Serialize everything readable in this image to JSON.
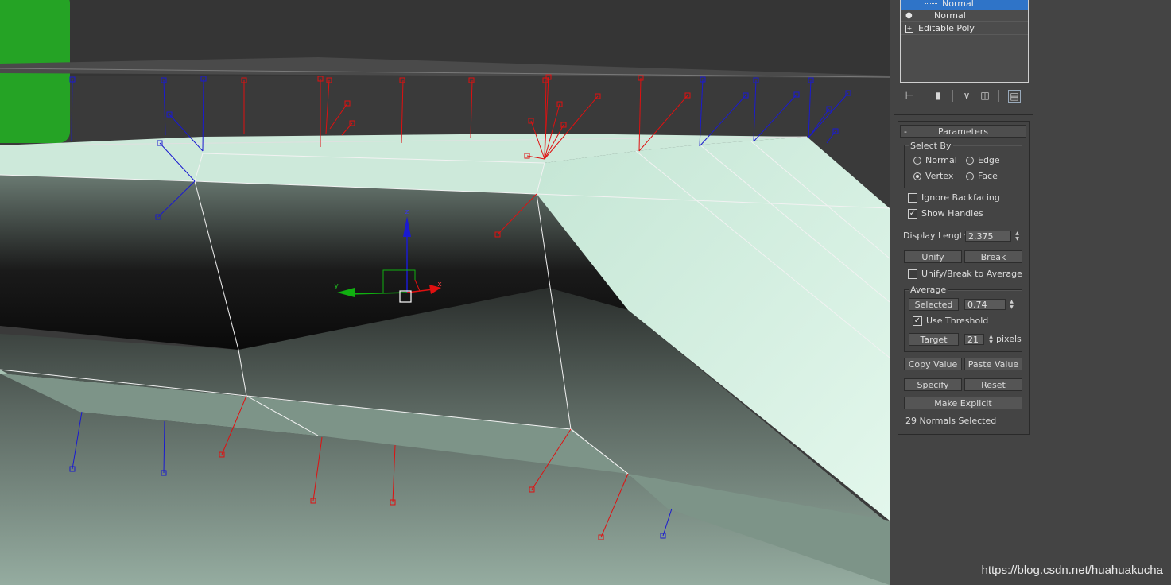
{
  "modifier_stack": {
    "items": [
      {
        "label": "Normal",
        "selected": true
      },
      {
        "label": "Normal",
        "selected": false
      },
      {
        "label": "Editable Poly",
        "selected": false
      }
    ]
  },
  "stack_toolbar": {
    "icons": [
      "pin-stack-icon",
      "show-end-result-icon",
      "make-unique-icon",
      "remove-modifier-icon",
      "configure-modifier-sets-icon"
    ]
  },
  "parameters": {
    "rollout_collapse": "-",
    "title": "Parameters",
    "select_by": {
      "label": "Select By",
      "options": [
        "Normal",
        "Edge",
        "Vertex",
        "Face"
      ],
      "selected": "Vertex"
    },
    "ignore_backfacing": {
      "label": "Ignore Backfacing",
      "checked": false
    },
    "show_handles": {
      "label": "Show Handles",
      "checked": true
    },
    "display_length": {
      "label": "Display Length:",
      "value": "2.375"
    },
    "unify_button": "Unify",
    "break_button": "Break",
    "unify_break_avg": {
      "label": "Unify/Break to Average",
      "checked": false
    },
    "average": {
      "label": "Average",
      "selected_button": "Selected",
      "selected_value": "0.74",
      "use_threshold": {
        "label": "Use Threshold",
        "checked": true
      },
      "target_button": "Target",
      "target_value": "21",
      "target_unit": "pixels"
    },
    "copy_value_button": "Copy Value",
    "paste_value_button": "Paste Value",
    "specify_button": "Specify",
    "reset_button": "Reset",
    "make_explicit_button": "Make Explicit",
    "status": "29 Normals Selected"
  },
  "viewport": {
    "gizmo_axes": {
      "x": "x",
      "y": "y",
      "z": "z"
    },
    "colors": {
      "background": "#3a3a3a",
      "mesh_light": "#cfeede",
      "normal_selected": "#e01010",
      "normal_unselected": "#1a1ad0",
      "axis_x": "#e01010",
      "axis_y": "#10b010",
      "axis_z": "#1a1ad0"
    }
  },
  "watermark": "https://blog.csdn.net/huahuakucha"
}
